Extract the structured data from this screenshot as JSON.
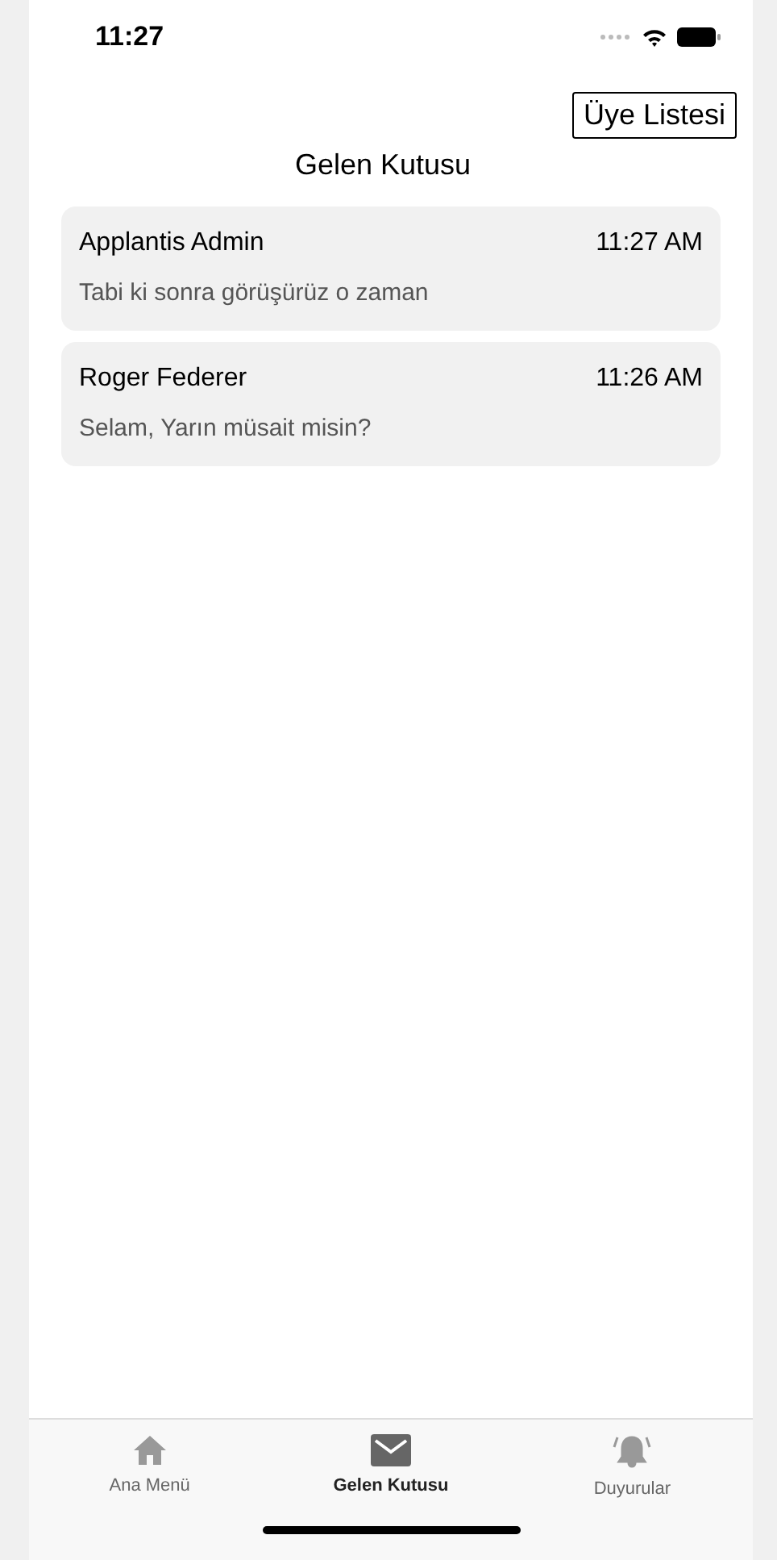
{
  "status_bar": {
    "time": "11:27"
  },
  "header": {
    "button": "Üye Listesi",
    "title": "Gelen Kutusu"
  },
  "messages": [
    {
      "sender": "Applantis Admin",
      "time": "11:27 AM",
      "preview": "Tabi ki sonra görüşürüz o zaman"
    },
    {
      "sender": "Roger Federer",
      "time": "11:26 AM",
      "preview": "Selam, Yarın müsait misin?"
    }
  ],
  "tabs": [
    {
      "label": "Ana Menü",
      "kind": "home",
      "selected": false
    },
    {
      "label": "Gelen Kutusu",
      "kind": "mail",
      "selected": true
    },
    {
      "label": "Duyurular",
      "kind": "bell",
      "selected": false
    }
  ]
}
